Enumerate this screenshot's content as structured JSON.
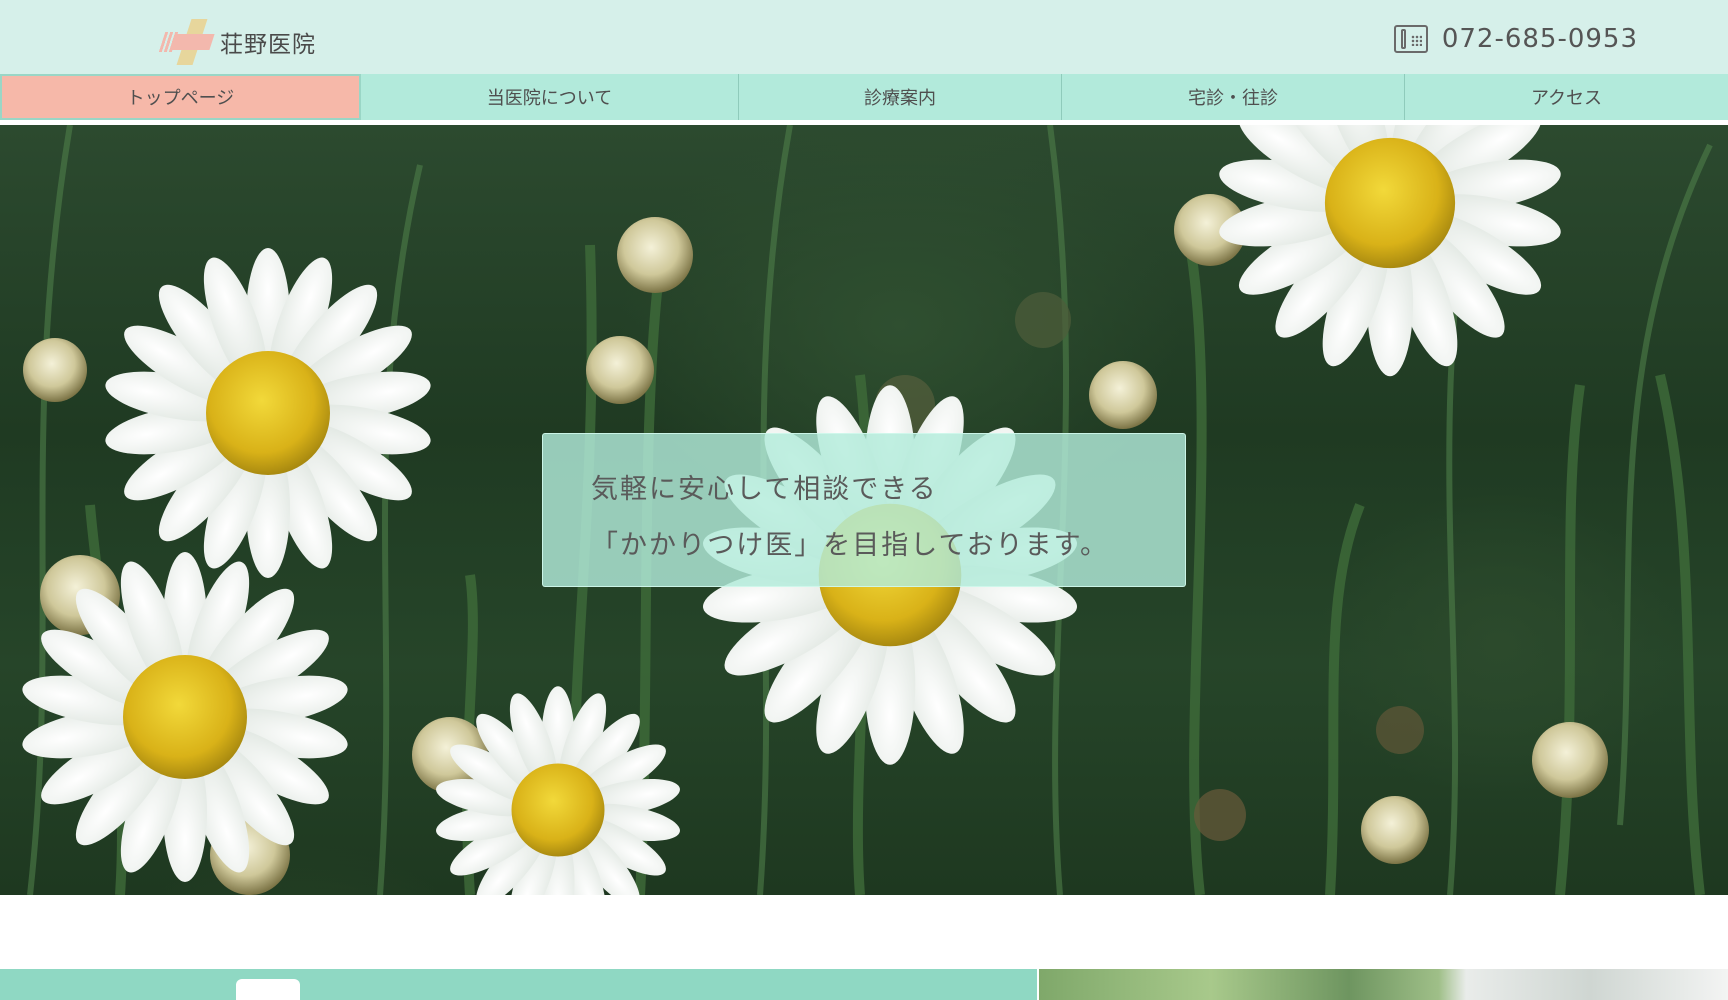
{
  "header": {
    "clinic_name": "荘野医院",
    "phone_number": "072-685-0953"
  },
  "nav": {
    "items": [
      {
        "label": "トップページ",
        "active": true
      },
      {
        "label": "当医院について",
        "active": false
      },
      {
        "label": "診療案内",
        "active": false
      },
      {
        "label": "宅診・往診",
        "active": false
      },
      {
        "label": "アクセス",
        "active": false
      }
    ]
  },
  "hero": {
    "caption_line1": "気軽に安心して相談できる",
    "caption_line2": "「かかりつけ医」を目指しております。"
  },
  "colors": {
    "header_bg": "#d6f0ea",
    "nav_bg": "#b2eadb",
    "nav_active": "#f6b8a9",
    "accent_band": "#8fd8c3"
  },
  "icons": {
    "logo": "clinic-cross-logo-icon",
    "phone": "fax-phone-icon"
  }
}
